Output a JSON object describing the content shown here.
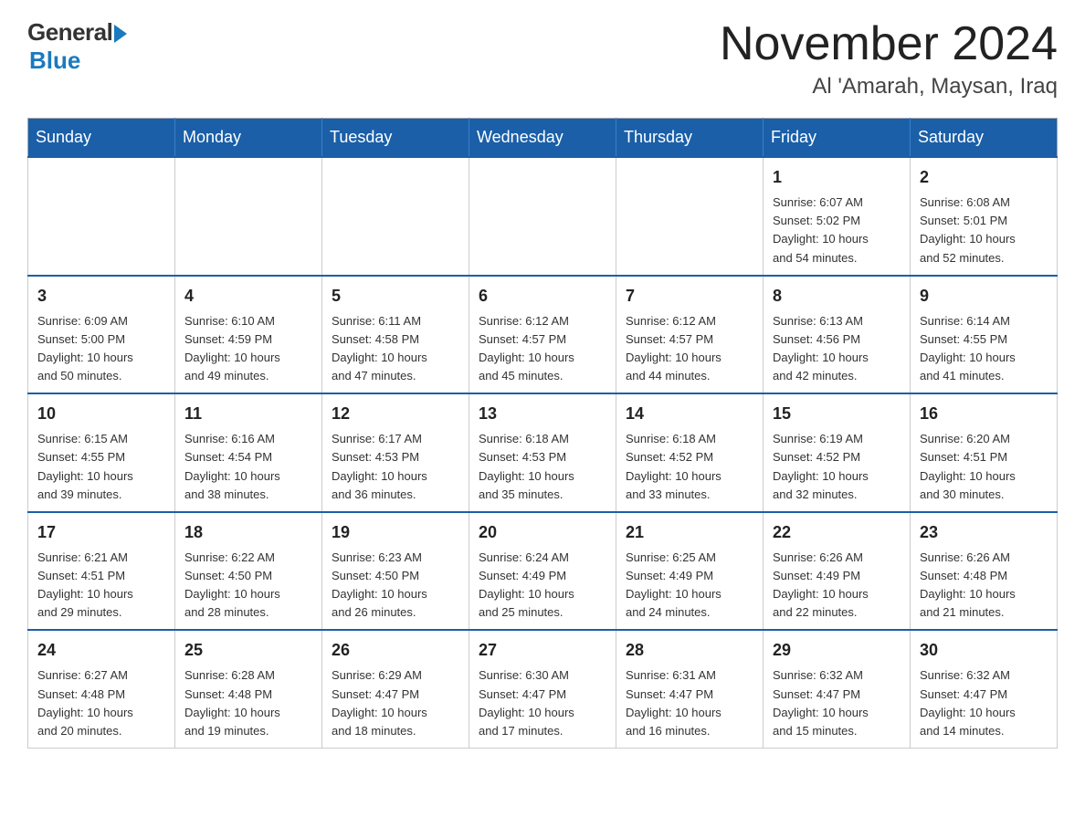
{
  "header": {
    "logo_general": "General",
    "logo_blue": "Blue",
    "month_title": "November 2024",
    "location": "Al 'Amarah, Maysan, Iraq"
  },
  "weekdays": [
    "Sunday",
    "Monday",
    "Tuesday",
    "Wednesday",
    "Thursday",
    "Friday",
    "Saturday"
  ],
  "weeks": [
    [
      {
        "day": "",
        "info": ""
      },
      {
        "day": "",
        "info": ""
      },
      {
        "day": "",
        "info": ""
      },
      {
        "day": "",
        "info": ""
      },
      {
        "day": "",
        "info": ""
      },
      {
        "day": "1",
        "info": "Sunrise: 6:07 AM\nSunset: 5:02 PM\nDaylight: 10 hours\nand 54 minutes."
      },
      {
        "day": "2",
        "info": "Sunrise: 6:08 AM\nSunset: 5:01 PM\nDaylight: 10 hours\nand 52 minutes."
      }
    ],
    [
      {
        "day": "3",
        "info": "Sunrise: 6:09 AM\nSunset: 5:00 PM\nDaylight: 10 hours\nand 50 minutes."
      },
      {
        "day": "4",
        "info": "Sunrise: 6:10 AM\nSunset: 4:59 PM\nDaylight: 10 hours\nand 49 minutes."
      },
      {
        "day": "5",
        "info": "Sunrise: 6:11 AM\nSunset: 4:58 PM\nDaylight: 10 hours\nand 47 minutes."
      },
      {
        "day": "6",
        "info": "Sunrise: 6:12 AM\nSunset: 4:57 PM\nDaylight: 10 hours\nand 45 minutes."
      },
      {
        "day": "7",
        "info": "Sunrise: 6:12 AM\nSunset: 4:57 PM\nDaylight: 10 hours\nand 44 minutes."
      },
      {
        "day": "8",
        "info": "Sunrise: 6:13 AM\nSunset: 4:56 PM\nDaylight: 10 hours\nand 42 minutes."
      },
      {
        "day": "9",
        "info": "Sunrise: 6:14 AM\nSunset: 4:55 PM\nDaylight: 10 hours\nand 41 minutes."
      }
    ],
    [
      {
        "day": "10",
        "info": "Sunrise: 6:15 AM\nSunset: 4:55 PM\nDaylight: 10 hours\nand 39 minutes."
      },
      {
        "day": "11",
        "info": "Sunrise: 6:16 AM\nSunset: 4:54 PM\nDaylight: 10 hours\nand 38 minutes."
      },
      {
        "day": "12",
        "info": "Sunrise: 6:17 AM\nSunset: 4:53 PM\nDaylight: 10 hours\nand 36 minutes."
      },
      {
        "day": "13",
        "info": "Sunrise: 6:18 AM\nSunset: 4:53 PM\nDaylight: 10 hours\nand 35 minutes."
      },
      {
        "day": "14",
        "info": "Sunrise: 6:18 AM\nSunset: 4:52 PM\nDaylight: 10 hours\nand 33 minutes."
      },
      {
        "day": "15",
        "info": "Sunrise: 6:19 AM\nSunset: 4:52 PM\nDaylight: 10 hours\nand 32 minutes."
      },
      {
        "day": "16",
        "info": "Sunrise: 6:20 AM\nSunset: 4:51 PM\nDaylight: 10 hours\nand 30 minutes."
      }
    ],
    [
      {
        "day": "17",
        "info": "Sunrise: 6:21 AM\nSunset: 4:51 PM\nDaylight: 10 hours\nand 29 minutes."
      },
      {
        "day": "18",
        "info": "Sunrise: 6:22 AM\nSunset: 4:50 PM\nDaylight: 10 hours\nand 28 minutes."
      },
      {
        "day": "19",
        "info": "Sunrise: 6:23 AM\nSunset: 4:50 PM\nDaylight: 10 hours\nand 26 minutes."
      },
      {
        "day": "20",
        "info": "Sunrise: 6:24 AM\nSunset: 4:49 PM\nDaylight: 10 hours\nand 25 minutes."
      },
      {
        "day": "21",
        "info": "Sunrise: 6:25 AM\nSunset: 4:49 PM\nDaylight: 10 hours\nand 24 minutes."
      },
      {
        "day": "22",
        "info": "Sunrise: 6:26 AM\nSunset: 4:49 PM\nDaylight: 10 hours\nand 22 minutes."
      },
      {
        "day": "23",
        "info": "Sunrise: 6:26 AM\nSunset: 4:48 PM\nDaylight: 10 hours\nand 21 minutes."
      }
    ],
    [
      {
        "day": "24",
        "info": "Sunrise: 6:27 AM\nSunset: 4:48 PM\nDaylight: 10 hours\nand 20 minutes."
      },
      {
        "day": "25",
        "info": "Sunrise: 6:28 AM\nSunset: 4:48 PM\nDaylight: 10 hours\nand 19 minutes."
      },
      {
        "day": "26",
        "info": "Sunrise: 6:29 AM\nSunset: 4:47 PM\nDaylight: 10 hours\nand 18 minutes."
      },
      {
        "day": "27",
        "info": "Sunrise: 6:30 AM\nSunset: 4:47 PM\nDaylight: 10 hours\nand 17 minutes."
      },
      {
        "day": "28",
        "info": "Sunrise: 6:31 AM\nSunset: 4:47 PM\nDaylight: 10 hours\nand 16 minutes."
      },
      {
        "day": "29",
        "info": "Sunrise: 6:32 AM\nSunset: 4:47 PM\nDaylight: 10 hours\nand 15 minutes."
      },
      {
        "day": "30",
        "info": "Sunrise: 6:32 AM\nSunset: 4:47 PM\nDaylight: 10 hours\nand 14 minutes."
      }
    ]
  ]
}
